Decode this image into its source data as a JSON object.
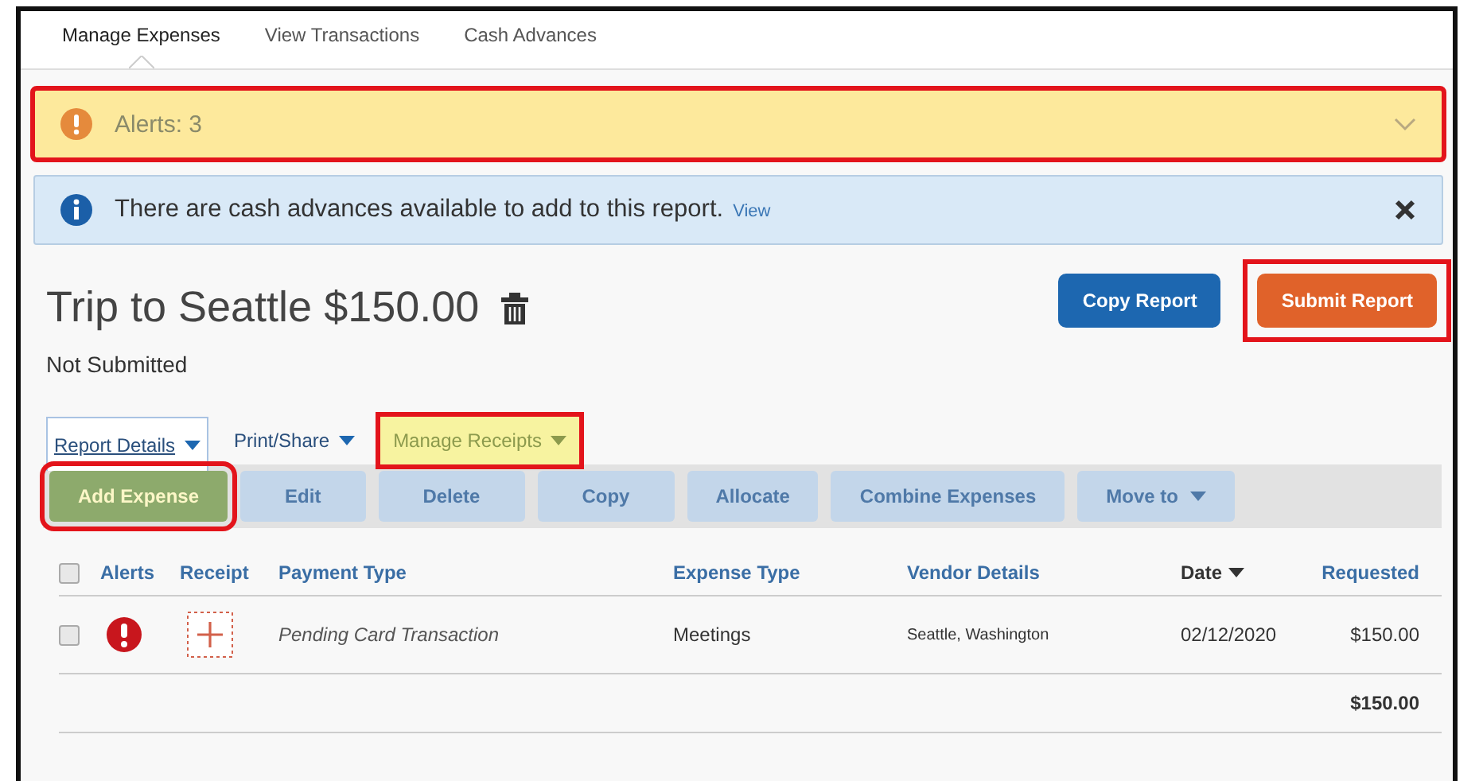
{
  "tabs": [
    {
      "label": "Manage Expenses",
      "selected": true
    },
    {
      "label": "View Transactions",
      "selected": false
    },
    {
      "label": "Cash Advances",
      "selected": false
    }
  ],
  "alert_bar": {
    "label": "Alerts: 3",
    "expanded": false,
    "highlighted": true
  },
  "info_bar": {
    "message": "There are cash advances available to add to this report.",
    "link": "View"
  },
  "report": {
    "title": "Trip to Seattle $150.00",
    "status": "Not Submitted"
  },
  "header_buttons": [
    {
      "label": "Copy Report",
      "kind": "primary",
      "highlighted": false
    },
    {
      "label": "Submit Report",
      "kind": "submit",
      "highlighted": true
    }
  ],
  "menus": [
    {
      "label": "Report Details",
      "selected": true,
      "highlighted": false
    },
    {
      "label": "Print/Share",
      "selected": false,
      "highlighted": false
    },
    {
      "label": "Manage Receipts",
      "selected": false,
      "highlighted": true
    }
  ],
  "toolbar": [
    {
      "label": "Add Expense",
      "disabled": false,
      "highlighted": true,
      "dropdown": false
    },
    {
      "label": "Edit",
      "disabled": true,
      "highlighted": false,
      "dropdown": false
    },
    {
      "label": "Delete",
      "disabled": true,
      "highlighted": false,
      "dropdown": false
    },
    {
      "label": "Copy",
      "disabled": true,
      "highlighted": false,
      "dropdown": false
    },
    {
      "label": "Allocate",
      "disabled": true,
      "highlighted": false,
      "dropdown": false
    },
    {
      "label": "Combine Expenses",
      "disabled": true,
      "highlighted": false,
      "dropdown": false
    },
    {
      "label": "Move to",
      "disabled": true,
      "highlighted": false,
      "dropdown": true
    }
  ],
  "table": {
    "all_checked": false,
    "columns": [
      {
        "label": "Alerts",
        "sorted": false
      },
      {
        "label": "Receipt",
        "sorted": false
      },
      {
        "label": "Payment Type",
        "sorted": false
      },
      {
        "label": "Expense Type",
        "sorted": false
      },
      {
        "label": "Vendor Details",
        "sorted": false
      },
      {
        "label": "Date",
        "sorted": true
      },
      {
        "label": "Requested",
        "sorted": false
      }
    ],
    "rows": [
      {
        "checked": false,
        "alert": true,
        "receipt_missing": true,
        "payment_type": "Pending Card Transaction",
        "expense_type": "Meetings",
        "vendor_details": "Seattle, Washington",
        "date": "02/12/2020",
        "requested": "$150.00"
      }
    ],
    "total": "$150.00"
  }
}
